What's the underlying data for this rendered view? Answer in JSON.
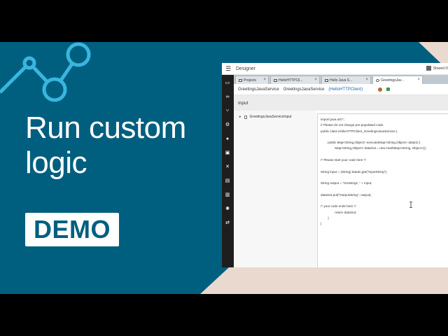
{
  "slide": {
    "title": "Run custom\nlogic",
    "badge": "DEMO",
    "colors": {
      "background": "#005f7f",
      "accent": "#39b6e0",
      "decor": "#ead9cf"
    }
  },
  "app": {
    "title": "Designer",
    "account_label": "Shared D",
    "sidebar_icons": [
      "folder-icon",
      "link-icon",
      "branch-icon",
      "settings-icon",
      "location-icon",
      "box-icon",
      "connector-icon",
      "document-icon",
      "chart-icon",
      "gear-icon",
      "transfer-icon"
    ],
    "tabs": [
      {
        "label": "Projects",
        "active": false
      },
      {
        "label": "HelloHTTPCli...",
        "active": false
      },
      {
        "label": "Hello Java S...",
        "active": false
      },
      {
        "label": "GreetingsJav...",
        "active": true
      }
    ],
    "breadcrumb": {
      "parent": "GreetingsJavaService",
      "current": "GreetingsJavaService",
      "link": "(HelloHTTPClient)"
    },
    "section_title": "Input",
    "tree_item": "GreetingsJavaServiceInput",
    "code_lines": [
      "import java.util.*;",
      "// Please do not change pre-populated code.",
      "public class HelloHTTPClient_GreetingsJavaService {",
      "",
      "        public Map<String,Object> execute(Map<String,Object> dataIn) {",
      "                Map<String,Object> dataOut = new HashMap<String, Object>();",
      "",
      "/* Please start your code here */",
      "",
      "String input = (String) dataIn.get(\"InputString\");",
      "",
      "String output = \"Greetings, \" + input;",
      "",
      "dataOut.put(\"OutputString\", output);",
      "",
      "/* your code ends here */",
      "                return dataOut;",
      "        }",
      "}"
    ]
  }
}
